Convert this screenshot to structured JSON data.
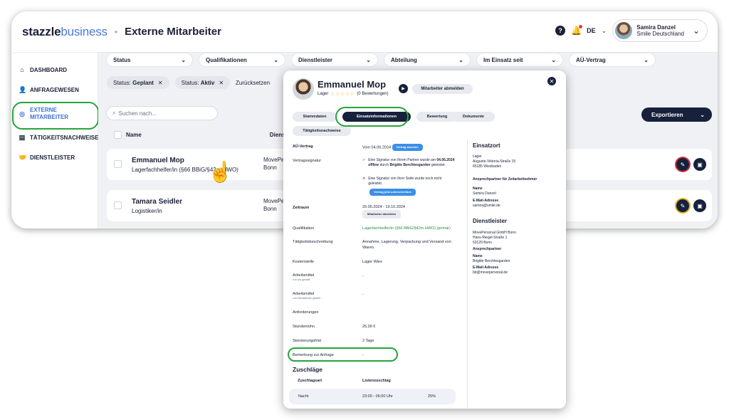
{
  "app": {
    "logo_main": "stazzle",
    "logo_sub": "business",
    "page_title": "Externe Mitarbeiter",
    "language": "DE",
    "user": {
      "name": "Samira Danzel",
      "org": "Smile Deutschland"
    }
  },
  "sidebar": {
    "items": [
      {
        "label": "DASHBOARD",
        "icon": "home-icon"
      },
      {
        "label": "ANFRAGEWESEN",
        "icon": "user-plus-icon"
      },
      {
        "label": "EXTERNE MITARBEITER",
        "icon": "target-icon",
        "active": true
      },
      {
        "label": "TÄTIGKEITSNACHWEISE",
        "icon": "list-icon"
      },
      {
        "label": "DIENSTLEISTER",
        "icon": "handshake-icon"
      }
    ]
  },
  "filters": [
    "Status",
    "Qualifikationen",
    "Dienstleister",
    "Abteilung",
    "Im Einsatz seit",
    "AÜ-Vertrag"
  ],
  "chips": [
    {
      "key": "Status:",
      "value": "Geplant"
    },
    {
      "key": "Status:",
      "value": "Aktiv"
    }
  ],
  "reset_label": "Zurücksetzen",
  "search_placeholder": "Suchen nach...",
  "export_label": "Exportieren",
  "table": {
    "col_name": "Name",
    "col_provider": "Dienstl",
    "rows": [
      {
        "name": "Emmanuel Mop",
        "role": "Lagerfachhelfer/in (§66 BBiG/§42m HWO)",
        "provider_line1": "MovePe",
        "provider_line2": "Bonn"
      },
      {
        "name": "Tamara Seidler",
        "role": "Logistiker/in",
        "provider_line1": "MovePe",
        "provider_line2": "Bonn"
      }
    ]
  },
  "modal": {
    "name": "Emmanuel Mop",
    "dept": "Lager",
    "stars": "☆☆☆☆☆",
    "ratings": "(0 Bewertungen)",
    "deregister_label": "Mitarbeiter abmelden",
    "tabs": [
      "Stammdaten",
      "Einsatzinformationen",
      "Bewertung",
      "Dokumente",
      "Tätigkeitsnachweise"
    ],
    "fields": {
      "aue_label": "AÜ-Vertrag",
      "aue_value": "Vom 04.06.2024",
      "aue_badge": "Vertrag ansehen",
      "signature_label": "Vertragssignatur",
      "sig1_a": "Eine Signatur von Ihrem Partner wurde am",
      "sig1_date": "04.06.2024 offline",
      "sig1_b": "durch",
      "sig1_person": "Brigitte Berchtesgarden",
      "sig1_c": "geleistet.",
      "sig2": "Eine Signatur von Ihrer Seite wurde noch nicht geleistet.",
      "sign_button": "Vertrag jetzt unterschreiben",
      "period_label": "Zeitraum",
      "period_value": "20.05.2024 - 19.10.2024",
      "period_button": "Mitarbeiter abmelden",
      "qual_label": "Qualifikation",
      "qual_value": "Lagerfachhelfer/in (§66 BBiG/§42m HWO) (primär)",
      "task_label": "Tätigkeitsbeschreibung",
      "task_value": "Annahme, Lagerung, Verpackung und Versand von Waren.",
      "cost_label": "Kostenstelle",
      "cost_value": "Lager Wies",
      "tools1_label": "Arbeitsmittel",
      "tools1_sub": "von uns gestellt",
      "tools1_value": "-",
      "tools2_label": "Arbeitsmittel",
      "tools2_sub": "vom Dienstleister gestellt",
      "tools2_value": "-",
      "req_label": "Anforderungen",
      "wage_label": "Stundenlohn",
      "wage_value": "25,00 €",
      "cancel_label": "Stornierungsfrist",
      "cancel_value": "2 Tage",
      "remark_label": "Bemerkung zur Anfrage",
      "remark_value": "-"
    },
    "right": {
      "einsatzort_title": "Einsatzort",
      "einsatzort_name": "Lager",
      "einsatzort_street": "Auguste-Viktoria-Straße 15",
      "einsatzort_city": "65185 Wiesbaden",
      "contact_title": "Ansprechpartner für Zeitarbeitnehmer",
      "name_label": "Name",
      "contact_name": "Samira Danzel",
      "email_label": "E-Mail-Adresse",
      "contact_email": "samira@smile.de",
      "provider_title": "Dienstleister",
      "provider_name": "MovePersonal GmbH Bonn",
      "provider_street": "Hans-Riegel-Straße 1",
      "provider_city": "53129 Bonn",
      "provider_contact_title": "Ansprechpartner",
      "provider_name_label": "Name",
      "provider_contact_name": "Brigitte Berchtesgarden",
      "provider_email_label": "E-Mail-Adresse",
      "provider_email": "bb@movepersonal.de"
    },
    "surcharges": {
      "title": "Zuschläge",
      "col_type": "Zuschlagsart",
      "col_list": "Listenzuschlag",
      "row_type": "Nacht",
      "row_time": "23:00 - 06:00 Uhr",
      "row_pct": "25%"
    }
  }
}
